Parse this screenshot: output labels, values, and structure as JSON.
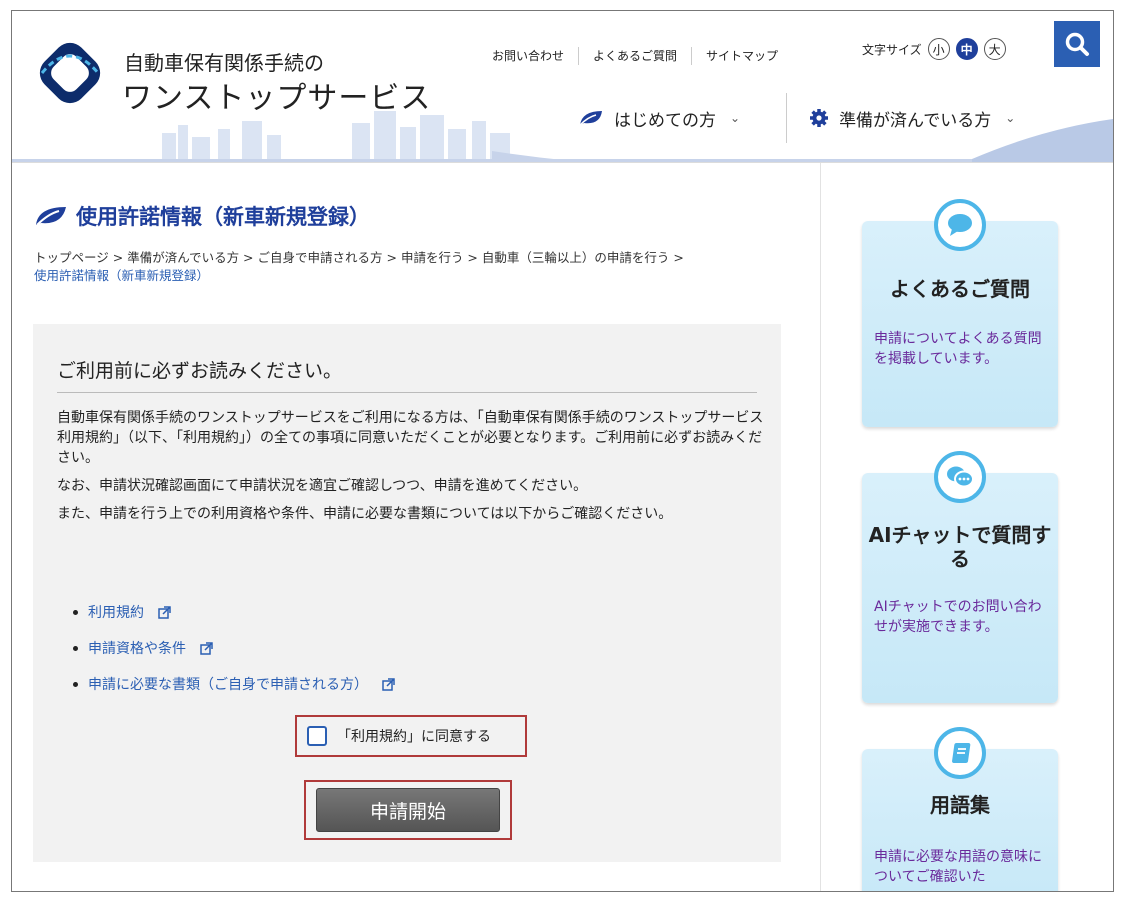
{
  "site": {
    "name_line1": "自動車保有関係手続の",
    "name_line2": "ワンストップサービス"
  },
  "utility_nav": [
    {
      "label": "お問い合わせ"
    },
    {
      "label": "よくあるご質問"
    },
    {
      "label": "サイトマップ"
    }
  ],
  "font_size": {
    "label": "文字サイズ",
    "options": [
      "小",
      "中",
      "大"
    ],
    "selected": "中"
  },
  "main_nav": [
    {
      "label": "はじめての方",
      "icon": "leaf-icon"
    },
    {
      "label": "準備が済んでいる方",
      "icon": "gear-icon"
    }
  ],
  "page": {
    "title": "使用許諾情報（新車新規登録）",
    "breadcrumb": [
      "トップページ",
      "準備が済んでいる方",
      "ご自身で申請される方",
      "申請を行う",
      "自動車（三輪以上）の申請を行う"
    ],
    "breadcrumb_current": "使用許諾情報（新車新規登録）"
  },
  "notice": {
    "heading": "ご利用前に必ずお読みください。",
    "paragraph1": "自動車保有関係手続のワンストップサービスをご利用になる方は、「自動車保有関係手続のワンストップサービス利用規約」（以下、「利用規約」）の全ての事項に同意いただくことが必要となります。ご利用前に必ずお読みください。",
    "paragraph2": "なお、申請状況確認画面にて申請状況を適宜ご確認しつつ、申請を進めてください。",
    "paragraph3": "また、申請を行う上での利用資格や条件、申請に必要な書類については以下からご確認ください。",
    "links": [
      {
        "label": "利用規約"
      },
      {
        "label": "申請資格や条件"
      },
      {
        "label": "申請に必要な書類（ご自身で申請される方）"
      }
    ],
    "agree_label": "「利用規約」に同意する",
    "agree_checked": false,
    "start_label": "申請開始"
  },
  "sidebar": {
    "cards": [
      {
        "title": "よくあるご質問",
        "text": "申請についてよくある質問を掲載しています。",
        "icon": "speech-bubble-icon"
      },
      {
        "title": "AIチャットで質問する",
        "text": "AIチャットでのお問い合わせが実施できます。",
        "icon": "chat-bubbles-icon"
      },
      {
        "title": "用語集",
        "text": "申請に必要な用語の意味についてご確認いた",
        "icon": "book-icon"
      }
    ]
  },
  "colors": {
    "brand_blue": "#1f3f9b",
    "link_blue": "#2b5fb3",
    "highlight_red": "#b03a3a",
    "card_text_purple": "#6a2a9b"
  }
}
